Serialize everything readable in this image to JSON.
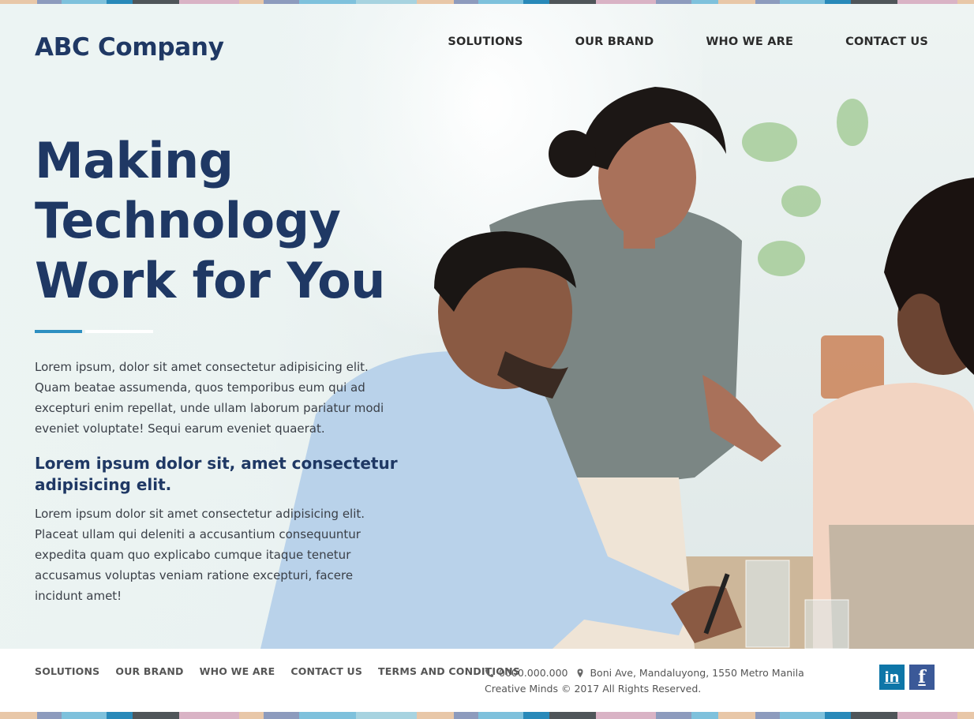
{
  "brand": {
    "name": "ABC Company",
    "primary_color": "#1f3864",
    "accent_color": "#2d8fc1"
  },
  "nav": {
    "items": [
      {
        "label": "SOLUTIONS"
      },
      {
        "label": "OUR BRAND"
      },
      {
        "label": "WHO WE ARE"
      },
      {
        "label": "CONTACT US"
      }
    ]
  },
  "hero": {
    "headline_line1": "Making",
    "headline_line2": "Technology",
    "headline_line3": "Work for You",
    "paragraph1": "Lorem ipsum, dolor sit amet consectetur adipisicing elit. Quam beatae assumenda, quos temporibus eum qui ad excepturi enim repellat, unde ullam laborum pariatur modi eveniet voluptate! Sequi earum eveniet quaerat.",
    "subheading": "Lorem ipsum dolor sit, amet consectetur adipisicing elit.",
    "paragraph2": "Lorem ipsum dolor sit amet consectetur adipisicing elit. Placeat ullam qui deleniti a accusantium consequuntur expedita quam quo explicabo cumque itaque tenetur accusamus voluptas veniam ratione excepturi, facere incidunt amet!"
  },
  "footer": {
    "links": [
      {
        "label": "SOLUTIONS"
      },
      {
        "label": "OUR BRAND"
      },
      {
        "label": "WHO WE ARE"
      },
      {
        "label": "CONTACT US"
      },
      {
        "label": "TERMS AND CONDITIONS"
      }
    ],
    "phone": "0000.000.000",
    "address": "Boni Ave, Mandaluyong, 1550 Metro Manila",
    "copyright": "Creative Minds © 2017 All Rights Reserved.",
    "phone_icon": "phone-icon",
    "location_icon": "location-pin-icon",
    "social": {
      "linkedin_label": "in",
      "facebook_label": "f"
    }
  },
  "stripe_colors": [
    "#e8c7a8",
    "#8d9bbd",
    "#7ec1dc",
    "#2889b9",
    "#4f5559",
    "#d9b3c5",
    "#e8c7a8",
    "#8d9bbd",
    "#7ec1dc",
    "#a7d3e0",
    "#e8c7a8",
    "#8d9bbd",
    "#7ec1dc",
    "#2889b9",
    "#4f5559",
    "#d9b3c5",
    "#8d9bbd",
    "#7ec1dc"
  ]
}
